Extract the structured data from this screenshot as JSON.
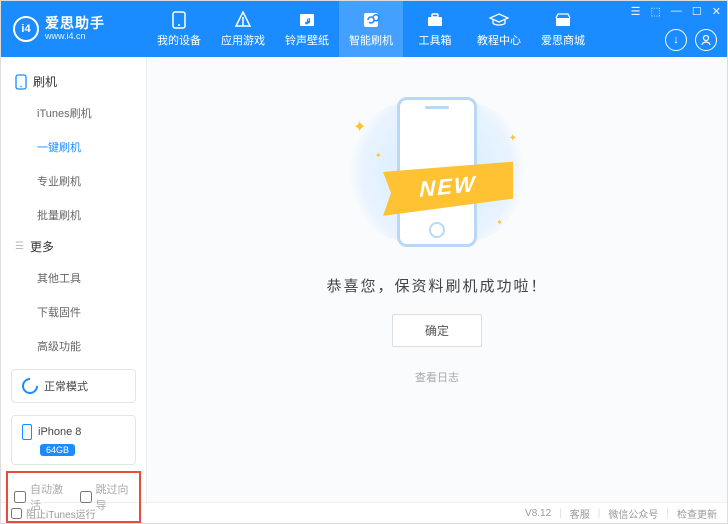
{
  "app": {
    "title": "爱思助手",
    "url": "www.i4.cn",
    "logo_text": "i4"
  },
  "nav": [
    {
      "label": "我的设备",
      "icon": "device-icon"
    },
    {
      "label": "应用游戏",
      "icon": "apps-icon"
    },
    {
      "label": "铃声壁纸",
      "icon": "music-icon"
    },
    {
      "label": "智能刷机",
      "icon": "flash-icon",
      "active": true
    },
    {
      "label": "工具箱",
      "icon": "toolbox-icon"
    },
    {
      "label": "教程中心",
      "icon": "tutorial-icon"
    },
    {
      "label": "爱思商城",
      "icon": "store-icon"
    }
  ],
  "sidebar": {
    "sections": [
      {
        "title": "刷机",
        "icon": "phone-icon",
        "items": [
          "iTunes刷机",
          "一键刷机",
          "专业刷机",
          "批量刷机"
        ],
        "active_index": 1
      },
      {
        "title": "更多",
        "icon": "burger-icon",
        "items": [
          "其他工具",
          "下载固件",
          "高级功能"
        ],
        "active_index": -1
      }
    ],
    "mode": {
      "label": "正常模式"
    },
    "device": {
      "name": "iPhone 8",
      "capacity": "64GB"
    },
    "checks": {
      "auto_activate": "自动激活",
      "skip_guide": "跳过向导"
    }
  },
  "main": {
    "ribbon_text": "NEW",
    "message": "恭喜您，保资料刷机成功啦！",
    "ok_label": "确定",
    "view_log": "查看日志"
  },
  "footer": {
    "block_itunes": "阻止iTunes运行",
    "version": "V8.12",
    "support": "客服",
    "wechat": "微信公众号",
    "update": "检查更新"
  }
}
